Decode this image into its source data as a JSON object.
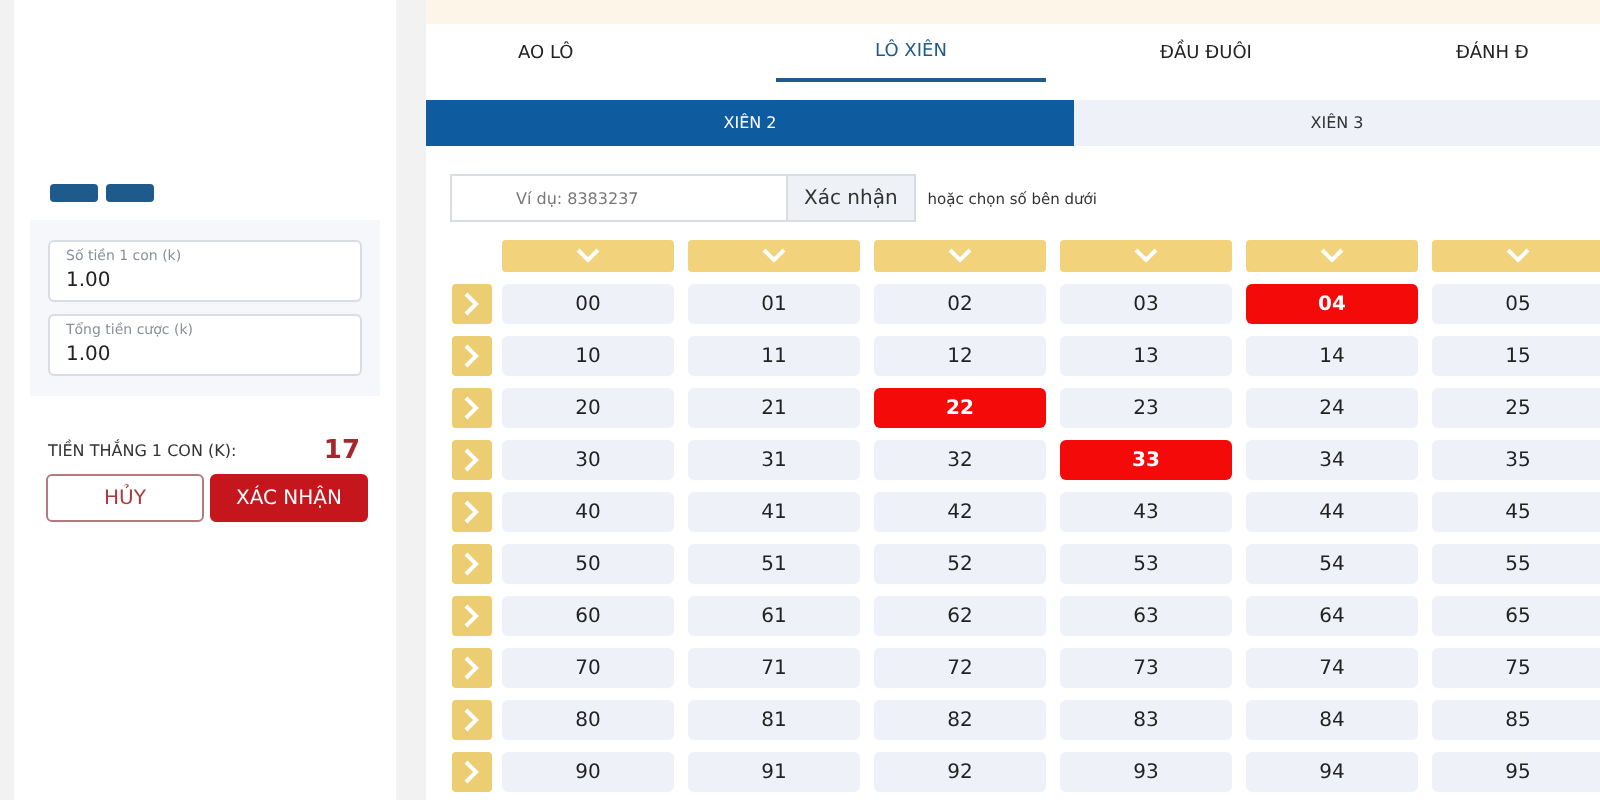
{
  "tabs": [
    {
      "label": "AO LÔ",
      "selected": false
    },
    {
      "label": "LÔ XIÊN",
      "selected": true
    },
    {
      "label": "ĐẦU ĐUÔI",
      "selected": false
    },
    {
      "label": "ĐÁNH Đ",
      "selected": false
    }
  ],
  "subtabs": [
    {
      "label": "XIÊN 2",
      "selected": true
    },
    {
      "label": "XIÊN 3",
      "selected": false
    }
  ],
  "number_input": {
    "placeholder": "Ví dụ: 8383237",
    "button": "Xác nhận",
    "hint": "hoặc chọn số bên dưới"
  },
  "bet_form": {
    "fields": [
      {
        "label": "Số tiền 1 con (k)",
        "value": "1.00"
      },
      {
        "label": "Tổng tiền cược (k)",
        "value": "1.00"
      }
    ],
    "win_label": "TIỀN THẮNG 1 CON (K):",
    "win_value": "17",
    "cancel": "HỦY",
    "confirm": "XÁC NHẬN"
  },
  "grid": {
    "rows": [
      {
        "cells": [
          {
            "label": "00",
            "selected": false
          },
          {
            "label": "01",
            "selected": false
          },
          {
            "label": "02",
            "selected": false
          },
          {
            "label": "03",
            "selected": false
          },
          {
            "label": "04",
            "selected": true
          },
          {
            "label": "05",
            "selected": false
          }
        ]
      },
      {
        "cells": [
          {
            "label": "10",
            "selected": false
          },
          {
            "label": "11",
            "selected": false
          },
          {
            "label": "12",
            "selected": false
          },
          {
            "label": "13",
            "selected": false
          },
          {
            "label": "14",
            "selected": false
          },
          {
            "label": "15",
            "selected": false
          }
        ]
      },
      {
        "cells": [
          {
            "label": "20",
            "selected": false
          },
          {
            "label": "21",
            "selected": false
          },
          {
            "label": "22",
            "selected": true
          },
          {
            "label": "23",
            "selected": false
          },
          {
            "label": "24",
            "selected": false
          },
          {
            "label": "25",
            "selected": false
          }
        ]
      },
      {
        "cells": [
          {
            "label": "30",
            "selected": false
          },
          {
            "label": "31",
            "selected": false
          },
          {
            "label": "32",
            "selected": false
          },
          {
            "label": "33",
            "selected": true
          },
          {
            "label": "34",
            "selected": false
          },
          {
            "label": "35",
            "selected": false
          }
        ]
      },
      {
        "cells": [
          {
            "label": "40",
            "selected": false
          },
          {
            "label": "41",
            "selected": false
          },
          {
            "label": "42",
            "selected": false
          },
          {
            "label": "43",
            "selected": false
          },
          {
            "label": "44",
            "selected": false
          },
          {
            "label": "45",
            "selected": false
          }
        ]
      },
      {
        "cells": [
          {
            "label": "50",
            "selected": false
          },
          {
            "label": "51",
            "selected": false
          },
          {
            "label": "52",
            "selected": false
          },
          {
            "label": "53",
            "selected": false
          },
          {
            "label": "54",
            "selected": false
          },
          {
            "label": "55",
            "selected": false
          }
        ]
      },
      {
        "cells": [
          {
            "label": "60",
            "selected": false
          },
          {
            "label": "61",
            "selected": false
          },
          {
            "label": "62",
            "selected": false
          },
          {
            "label": "63",
            "selected": false
          },
          {
            "label": "64",
            "selected": false
          },
          {
            "label": "65",
            "selected": false
          }
        ]
      },
      {
        "cells": [
          {
            "label": "70",
            "selected": false
          },
          {
            "label": "71",
            "selected": false
          },
          {
            "label": "72",
            "selected": false
          },
          {
            "label": "73",
            "selected": false
          },
          {
            "label": "74",
            "selected": false
          },
          {
            "label": "75",
            "selected": false
          }
        ]
      },
      {
        "cells": [
          {
            "label": "80",
            "selected": false
          },
          {
            "label": "81",
            "selected": false
          },
          {
            "label": "82",
            "selected": false
          },
          {
            "label": "83",
            "selected": false
          },
          {
            "label": "84",
            "selected": false
          },
          {
            "label": "85",
            "selected": false
          }
        ]
      },
      {
        "cells": [
          {
            "label": "90",
            "selected": false
          },
          {
            "label": "91",
            "selected": false
          },
          {
            "label": "92",
            "selected": false
          },
          {
            "label": "93",
            "selected": false
          },
          {
            "label": "94",
            "selected": false
          },
          {
            "label": "95",
            "selected": false
          }
        ]
      }
    ]
  }
}
